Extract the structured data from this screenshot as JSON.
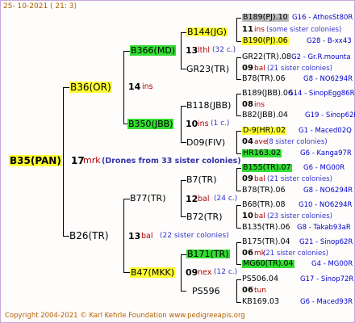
{
  "header": {
    "date": "25- 10-2021 ( 21: 3)"
  },
  "footer": {
    "copyright": "Copyright 2004-2021 © Karl Kehrle Foundation    www.pedigreeapis.org"
  },
  "root": {
    "name": "B35(PAN)",
    "num": "17",
    "race": "mrk",
    "comment": "(Drones from 33 sister colonies)"
  },
  "gen1": {
    "top": {
      "name": "B36(OR)",
      "num": "14",
      "race": "ins"
    },
    "bottom": {
      "name": "B26(TR)",
      "num": "13",
      "race": "bal",
      "comment": "(22 sister colonies)"
    }
  },
  "gen2": {
    "a": {
      "name": "B366(MD)",
      "num": "13",
      "race": "lthl",
      "comment": "(32 c.)"
    },
    "b": {
      "name": "B350(JBB)",
      "num": "10",
      "race": "ins",
      "comment": "(1 c.)"
    },
    "c": {
      "name": "B77(TR)",
      "num": "12",
      "race": "bal",
      "comment": "(24 c.)"
    },
    "d": {
      "name": "B47(MKK)",
      "num": "09",
      "race": "nex",
      "comment": "(12 c.)"
    }
  },
  "gen3": {
    "a1": {
      "name": "B144(JG)",
      "num": "11",
      "race": "ins",
      "comment": "(some sister colonies)"
    },
    "a2": {
      "name": "GR23(TR)",
      "num": "09",
      "race": "bal",
      "comment": "(21 sister colonies)"
    },
    "b1": {
      "name": "B118(JBB)",
      "num": "08",
      "race": "ins"
    },
    "b2": {
      "name": "D09(FIV)",
      "num": "04",
      "race": "ave",
      "comment": "(8 sister colonies)"
    },
    "c1": {
      "name": "B7(TR)",
      "num": "09",
      "race": "bal",
      "comment": "(21 sister colonies)"
    },
    "c2": {
      "name": "B72(TR)",
      "num": "10",
      "race": "bal",
      "comment": "(23 sister colonies)"
    },
    "d1": {
      "name": "B171(TR)",
      "num": "06",
      "race": "mk",
      "comment": "(21 sister colonies)"
    },
    "d2": {
      "name": "PS596",
      "num": "06",
      "race": "tun"
    }
  },
  "gen4": [
    {
      "name": "B189(PJ).10",
      "gid": "G16 - AthosSt80R"
    },
    {
      "name": "B190(PJ).06",
      "gid": "G28 - B-xx43"
    },
    {
      "name": "GR22(TR).08",
      "gid": "G2 - Gr.R.mounta"
    },
    {
      "name": "B78(TR).06",
      "gid": "G8 - NO6294R"
    },
    {
      "name": "B189(JBB).06",
      "gid": "G14 - SinopEgg86R"
    },
    {
      "name": "B82(JBB).04",
      "gid": "G19 - Sinop62R"
    },
    {
      "name": "D-9(HR).02",
      "gid": "G1 - Maced02Q"
    },
    {
      "name": "HR163.02",
      "gid": "G6 - Kanga97R"
    },
    {
      "name": "B155(TR).07",
      "gid": "G6 - MG00R"
    },
    {
      "name": "B78(TR).06",
      "gid": "G8 - NO6294R"
    },
    {
      "name": "B68(TR).08",
      "gid": "G10 - NO6294R"
    },
    {
      "name": "B135(TR).06",
      "gid": "G8 - Takab93aR"
    },
    {
      "name": "B175(TR).04",
      "gid": "G21 - Sinop62R"
    },
    {
      "name": "MG60(TR).04",
      "gid": "G4 - MG00R"
    },
    {
      "name": "PS506.04",
      "gid": "G17 - Sinop72R"
    },
    {
      "name": "KB169.03",
      "gid": "G6 - Maced93R"
    }
  ]
}
